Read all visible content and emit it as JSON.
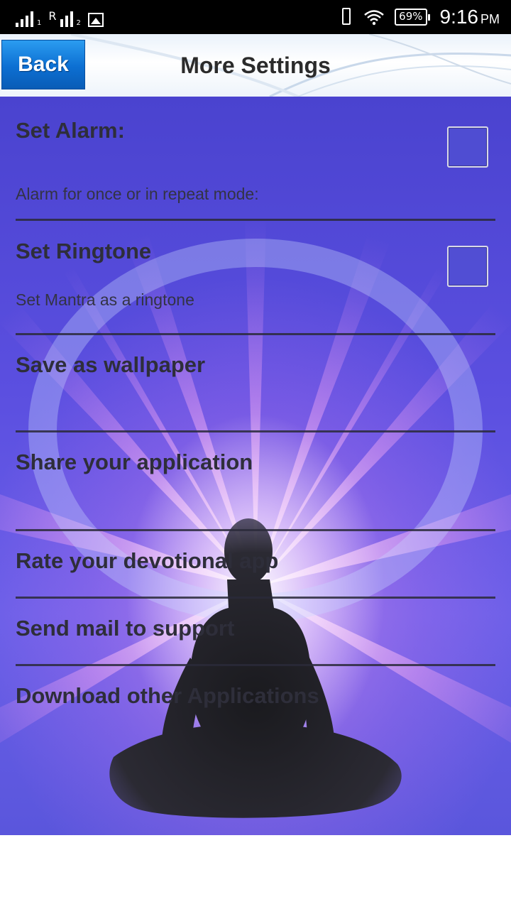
{
  "status_bar": {
    "time": "9:16",
    "ampm": "PM",
    "battery": "69%",
    "sim1": "1",
    "sim2": "2",
    "roaming": "R",
    "icons": [
      "signal-icon",
      "signal-roaming-icon",
      "image-icon",
      "vibrate-icon",
      "wifi-icon",
      "battery-icon"
    ]
  },
  "header": {
    "back_label": "Back",
    "title": "More Settings"
  },
  "settings": {
    "alarm": {
      "title": "Set Alarm:",
      "subtitle": "Alarm for once or in repeat mode:",
      "checked": false
    },
    "ringtone": {
      "title": "Set Ringtone",
      "subtitle": "Set Mantra as a ringtone",
      "checked": false
    },
    "wallpaper": {
      "title": "Save as wallpaper"
    },
    "share": {
      "title": "Share your application"
    },
    "rate": {
      "title": "Rate your devotional app"
    },
    "mail": {
      "title": "Send mail to support"
    },
    "download": {
      "title": "Download other Applications"
    }
  },
  "colors": {
    "back_button": "#0c6fd2",
    "background_purple": "#5b4fe0",
    "glow_pink": "#ec96f0",
    "text_dark": "#2e2e3a"
  }
}
